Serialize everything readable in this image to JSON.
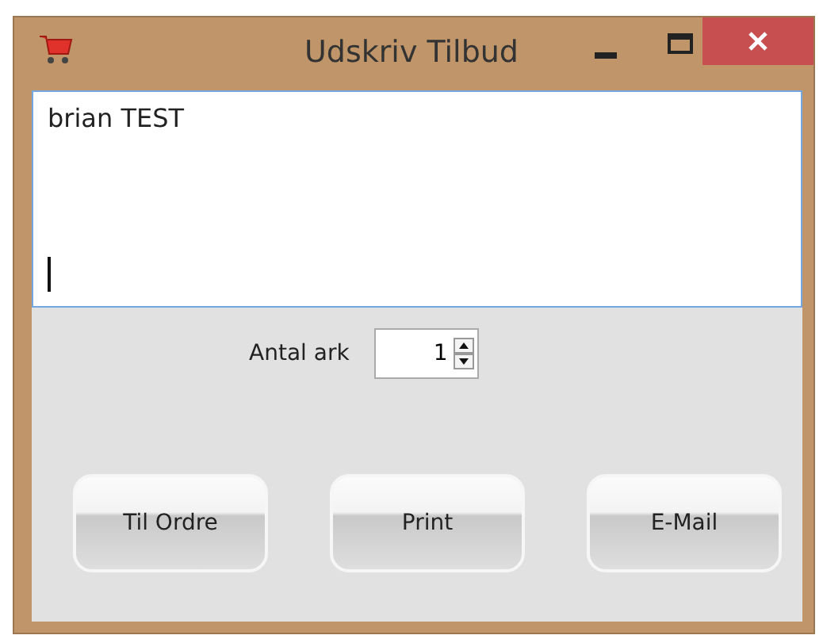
{
  "window": {
    "title": "Udskriv Tilbud"
  },
  "text_area": {
    "value": "brian TEST"
  },
  "sheets": {
    "label": "Antal ark",
    "value": "1"
  },
  "buttons": [
    "Til Ordre",
    "Print",
    "E-Mail"
  ]
}
